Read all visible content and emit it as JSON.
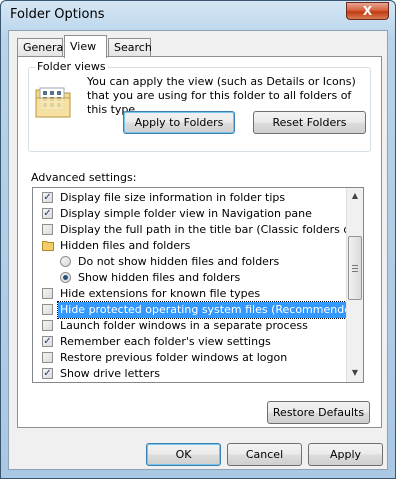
{
  "window": {
    "title": "Folder Options",
    "close_label": "X"
  },
  "tabs": [
    {
      "label": "General",
      "active": false
    },
    {
      "label": "View",
      "active": true
    },
    {
      "label": "Search",
      "active": false
    }
  ],
  "folder_views": {
    "group_label": "Folder views",
    "description": "You can apply the view (such as Details or Icons) that you are using for this folder to all folders of this type.",
    "apply_button": "Apply to Folders",
    "reset_button": "Reset Folders"
  },
  "advanced": {
    "label": "Advanced settings:",
    "items": [
      {
        "type": "checkbox",
        "checked": true,
        "label": "Display file size information in folder tips"
      },
      {
        "type": "checkbox",
        "checked": true,
        "label": "Display simple folder view in Navigation pane"
      },
      {
        "type": "checkbox",
        "checked": false,
        "label": "Display the full path in the title bar (Classic folders only)"
      },
      {
        "type": "folder",
        "label": "Hidden files and folders"
      },
      {
        "type": "radio",
        "checked": false,
        "label": "Do not show hidden files and folders"
      },
      {
        "type": "radio",
        "checked": true,
        "label": "Show hidden files and folders"
      },
      {
        "type": "checkbox",
        "checked": false,
        "label": "Hide extensions for known file types"
      },
      {
        "type": "checkbox",
        "checked": false,
        "label": "Hide protected operating system files (Recommended)",
        "selected": true
      },
      {
        "type": "checkbox",
        "checked": false,
        "label": "Launch folder windows in a separate process"
      },
      {
        "type": "checkbox",
        "checked": true,
        "label": "Remember each folder's view settings"
      },
      {
        "type": "checkbox",
        "checked": false,
        "label": "Restore previous folder windows at logon"
      },
      {
        "type": "checkbox",
        "checked": true,
        "label": "Show drive letters"
      }
    ],
    "restore_button": "Restore Defaults"
  },
  "footer": {
    "ok": "OK",
    "cancel": "Cancel",
    "apply": "Apply"
  },
  "colors": {
    "selection": "#3399ff",
    "title_gradient": "#b8d3ea",
    "close_button": "#c13a12"
  }
}
